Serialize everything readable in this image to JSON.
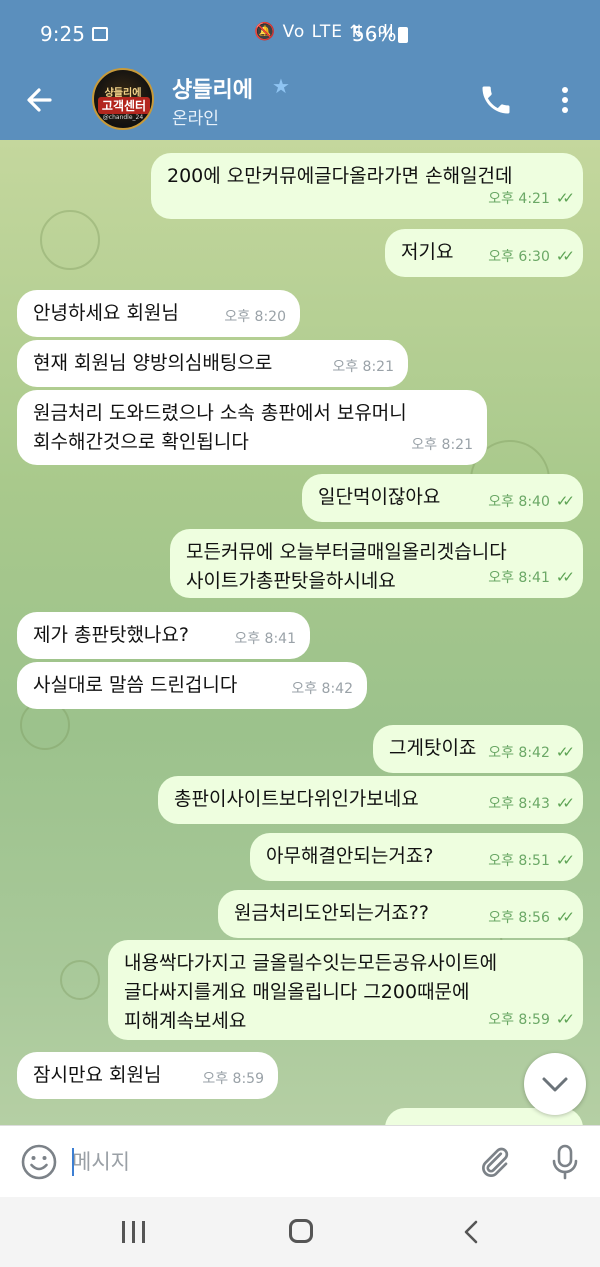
{
  "status_bar": {
    "time": "9:25",
    "network_icons": "🔕 Vo LTE ⇅ .ıll",
    "battery": "56%"
  },
  "header": {
    "chat_name": "샹들리에",
    "status": "온라인",
    "avatar": {
      "top_text": "샹들리에",
      "main_text": "고객센터",
      "sub_text": "@chandle_24"
    }
  },
  "messages": [
    {
      "direction": "out",
      "text": "200에 오만커뮤에글다올라가면 손해일건데",
      "time": "오후 4:21",
      "read": true
    },
    {
      "direction": "out",
      "text": "저기요",
      "time": "오후 6:30",
      "read": true
    },
    {
      "direction": "in",
      "text": "안녕하세요 회원님",
      "time": "오후 8:20"
    },
    {
      "direction": "in",
      "text": "현재 회원님 양방의심배팅으로",
      "time": "오후 8:21"
    },
    {
      "direction": "in",
      "text": "원금처리 도와드렸으나 소속 총판에서 보유머니\n회수해간것으로 확인됩니다",
      "time": "오후 8:21"
    },
    {
      "direction": "out",
      "text": "일단먹이잖아요",
      "time": "오후 8:40",
      "read": true
    },
    {
      "direction": "out",
      "text": "모든커뮤에 오늘부터글매일올리겟습니다\n사이트가총판탓을하시네요",
      "time": "오후 8:41",
      "read": true
    },
    {
      "direction": "in",
      "text": "제가 총판탓했나요?",
      "time": "오후 8:41"
    },
    {
      "direction": "in",
      "text": "사실대로 말씀 드린겁니다",
      "time": "오후 8:42"
    },
    {
      "direction": "out",
      "text": "그게탓이죠",
      "time": "오후 8:42",
      "read": true
    },
    {
      "direction": "out",
      "text": "총판이사이트보다위인가보네요",
      "time": "오후 8:43",
      "read": true
    },
    {
      "direction": "out",
      "text": "아무해결안되는거죠?",
      "time": "오후 8:51",
      "read": true
    },
    {
      "direction": "out",
      "text": "원금처리도안되는거죠??",
      "time": "오후 8:56",
      "read": true
    },
    {
      "direction": "out",
      "text": "내용싹다가지고 글올릴수잇는모든공유사이트에\n글다싸지를게요 매일올립니다 그200때문에\n피해계속보세요",
      "time": "오후 8:59",
      "read": true
    },
    {
      "direction": "in",
      "text": "잠시만요 회원님",
      "time": "오후 8:59"
    },
    {
      "direction": "out",
      "text": "",
      "time": "",
      "read": false
    }
  ],
  "input": {
    "placeholder": "메시지"
  },
  "colors": {
    "header_bg": "#5b8fbd",
    "out_bubble": "#eefedf",
    "in_bubble": "#ffffff",
    "read_check": "#5ea455"
  },
  "icons": [
    "back-arrow-icon",
    "star-icon",
    "phone-icon",
    "more-vertical-icon",
    "emoji-icon",
    "paperclip-icon",
    "microphone-icon",
    "chevron-down-icon"
  ]
}
